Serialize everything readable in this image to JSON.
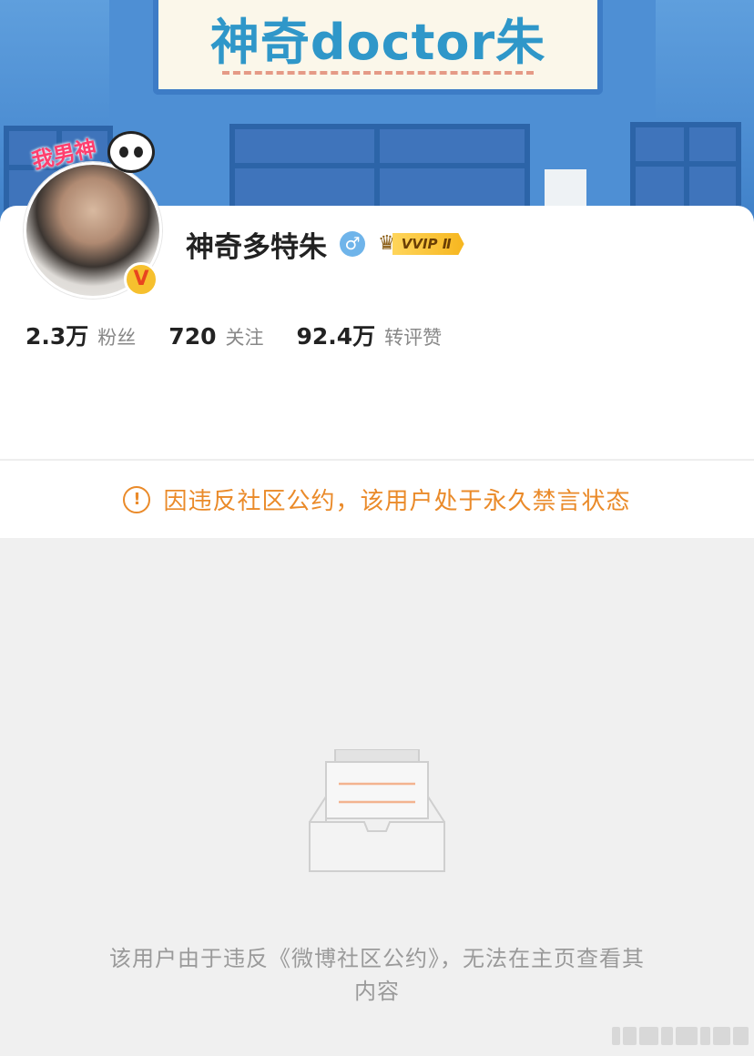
{
  "banner": {
    "sign_text": "神奇doctor朱"
  },
  "profile": {
    "avatar_sticker_text": "我男神",
    "username": "神奇多特朱",
    "gender_symbol": "♂",
    "vip_label": "VVIP Ⅱ",
    "verified_symbol": "V",
    "stats": [
      {
        "value": "2.3万",
        "label": "粉丝"
      },
      {
        "value": "720",
        "label": "关注"
      },
      {
        "value": "92.4万",
        "label": "转评赞"
      }
    ]
  },
  "notice": {
    "icon_symbol": "!",
    "text": "因违反社区公约，该用户处于永久禁言状态"
  },
  "empty_state": {
    "message_line1": "该用户由于违反《微博社区公约》，无法在主页查看其",
    "message_line2": "内容"
  },
  "colors": {
    "accent_orange": "#ea8a29",
    "gender_blue": "#6fb4ea",
    "vip_gold": "#f6b61f"
  },
  "icons": {
    "notice": "exclamation-circle-icon",
    "empty": "empty-inbox-icon",
    "gender": "male-icon",
    "vip": "crown-icon"
  }
}
